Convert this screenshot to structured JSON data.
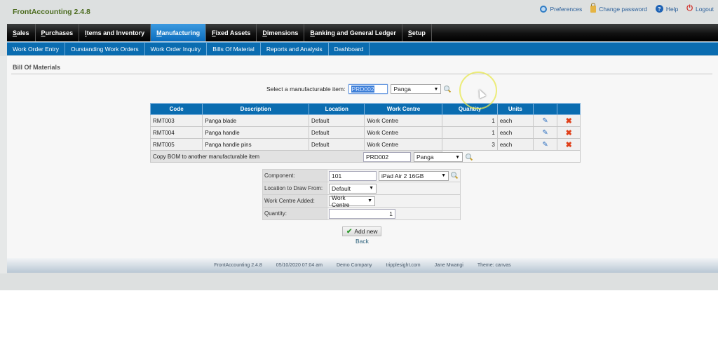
{
  "app": {
    "title": "FrontAccounting 2.4.8"
  },
  "toplinks": [
    {
      "label": "Preferences",
      "icon": "preferences-icon"
    },
    {
      "label": "Change password",
      "icon": "lock-icon"
    },
    {
      "label": "Help",
      "icon": "help-icon"
    },
    {
      "label": "Logout",
      "icon": "power-icon"
    }
  ],
  "mainnav": [
    {
      "first": "S",
      "rest": "ales",
      "active": false
    },
    {
      "first": "P",
      "rest": "urchases",
      "active": false
    },
    {
      "first": "I",
      "rest": "tems and Inventory",
      "active": false
    },
    {
      "first": "M",
      "rest": "anufacturing",
      "active": true
    },
    {
      "first": "F",
      "rest": "ixed Assets",
      "active": false
    },
    {
      "first": "D",
      "rest": "imensions",
      "active": false
    },
    {
      "first": "B",
      "rest": "anking and General Ledger",
      "active": false
    },
    {
      "first": "S",
      "rest": "etup",
      "active": false
    }
  ],
  "subnav": [
    "Work Order Entry",
    "Ourstanding Work Orders",
    "Work Order Inquiry",
    "Bills Of Material",
    "Reports and Analysis",
    "Dashboard"
  ],
  "page": {
    "title": "Bill Of Materials",
    "selector_label": "Select a manufacturable item:",
    "selector_code": "PRD002",
    "selector_item": "Panga"
  },
  "bom_table": {
    "headers": [
      "Code",
      "Description",
      "Location",
      "Work Centre",
      "Quantity",
      "Units",
      "",
      ""
    ],
    "rows": [
      {
        "code": "RMT003",
        "description": "Panga blade",
        "location": "Default",
        "work_centre": "Work Centre",
        "quantity": "1",
        "units": "each"
      },
      {
        "code": "RMT004",
        "description": "Panga handle",
        "location": "Default",
        "work_centre": "Work Centre",
        "quantity": "1",
        "units": "each"
      },
      {
        "code": "RMT005",
        "description": "Panga handle pins",
        "location": "Default",
        "work_centre": "Work Centre",
        "quantity": "3",
        "units": "each"
      }
    ],
    "copy_label": "Copy BOM to another manufacturable item",
    "copy_code": "PRD002",
    "copy_item": "Panga"
  },
  "form": {
    "component_label": "Component:",
    "component_code": "101",
    "component_item": "iPad Air 2 16GB",
    "location_label": "Location to Draw From:",
    "location_value": "Default",
    "workcentre_label": "Work Centre Added:",
    "workcentre_value": "Work Centre",
    "quantity_label": "Quantity:",
    "quantity_value": "1",
    "add_button": "Add new",
    "back_link": "Back"
  },
  "footer": {
    "version": "FrontAccounting 2.4.8",
    "datetime": "05/10/2020 07:04 am",
    "company": "Demo Company",
    "site": "tripplesight.com",
    "user": "Jane Mwangi",
    "theme": "Theme: canvas"
  }
}
